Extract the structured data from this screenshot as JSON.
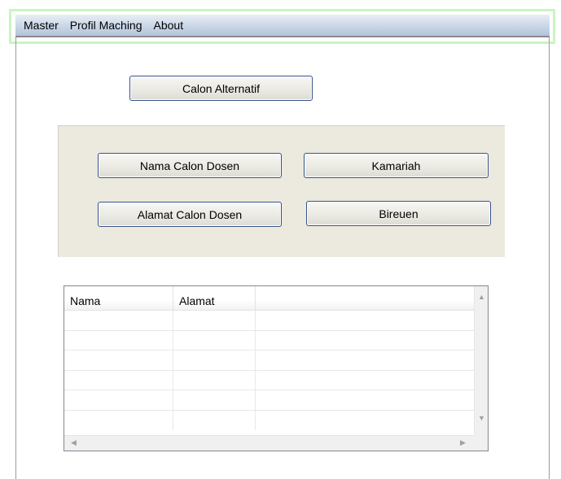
{
  "menu": {
    "items": [
      "Master",
      "Profil Maching",
      "About"
    ]
  },
  "buttons": {
    "calon_alternatif": "Calon Alternatif",
    "nama_calon_dosen": "Nama Calon Dosen",
    "nama_value": "Kamariah",
    "alamat_calon_dosen": "Alamat Calon Dosen",
    "alamat_value": "Bireuen"
  },
  "grid": {
    "columns": [
      "Nama",
      "Alamat",
      ""
    ],
    "row_count": 6
  },
  "colors": {
    "panel_bg": "#ece9df",
    "button_border": "#34548a",
    "menu_highlight": "#c8f5c0"
  },
  "icons": {
    "scroll_up": "scroll-up-arrow-icon",
    "scroll_down": "scroll-down-arrow-icon",
    "scroll_left": "scroll-left-arrow-icon",
    "scroll_right": "scroll-right-arrow-icon"
  }
}
